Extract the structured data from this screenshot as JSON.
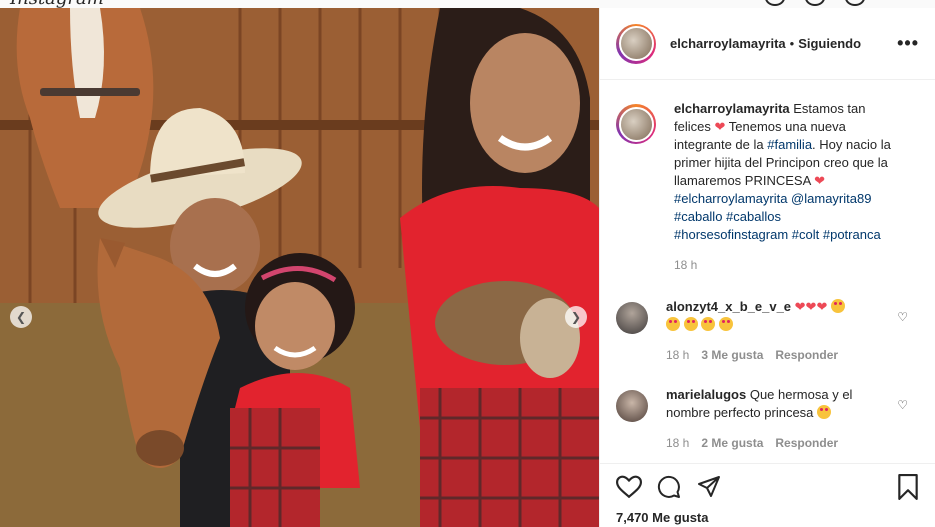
{
  "app": {
    "logo_text": "Instagram"
  },
  "post": {
    "username": "elcharroylamayrita",
    "separator": "•",
    "follow_status": "Siguiendo",
    "more_label": "•••"
  },
  "caption": {
    "username": "elcharroylamayrita",
    "text_1": "Estamos tan felices",
    "text_2": "Tenemos una nueva integrante de la",
    "tag_familia": "#familia",
    "text_3": ". Hoy nacio la primer hijita del Principon creo que la llamaremos PRINCESA",
    "tags_line_1": "#elcharroylamayrita @lamayrita89",
    "tags_line_2": "#caballo #caballos",
    "tags_line_3": "#horsesofinstagram #colt #potranca",
    "time": "18 h"
  },
  "comments": [
    {
      "username": "alonzyt4_x_b_e_v_e",
      "time": "18 h",
      "likes": "3 Me gusta",
      "reply": "Responder"
    },
    {
      "username": "marielalugos",
      "text": "Que hermosa y el nombre perfecto princesa",
      "time": "18 h",
      "likes": "2 Me gusta",
      "reply": "Responder"
    }
  ],
  "footer": {
    "likes_count": "7,470 Me gusta"
  },
  "icons": [
    "heart-icon",
    "comment-icon",
    "share-icon",
    "bookmark-icon",
    "more-icon",
    "chevron-left-icon",
    "chevron-right-icon"
  ],
  "colors": {
    "accent_heart": "#ed4956",
    "link": "#00376b",
    "muted": "#8e8e8e",
    "shirt_red": "#e2232e"
  }
}
